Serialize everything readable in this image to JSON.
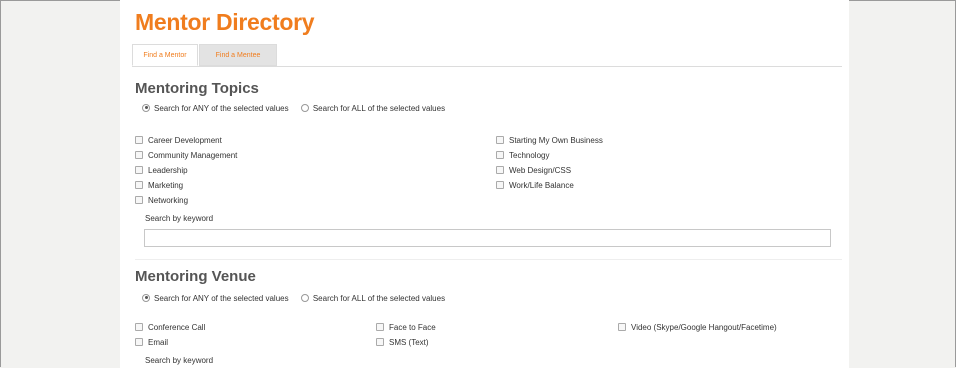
{
  "page_title": "Mentor Directory",
  "tabs": [
    {
      "label": "Find a Mentor",
      "active": true
    },
    {
      "label": "Find a Mentee",
      "active": false
    }
  ],
  "topics": {
    "title": "Mentoring Topics",
    "radio_any": "Search for ANY of the selected values",
    "radio_all": "Search for ALL of the selected values",
    "options_col1": [
      "Career Development",
      "Community Management",
      "Leadership",
      "Marketing",
      "Networking"
    ],
    "options_col2": [
      "Starting My Own Business",
      "Technology",
      "Web Design/CSS",
      "Work/Life Balance"
    ],
    "keyword_label": "Search by keyword",
    "keyword_value": ""
  },
  "venue": {
    "title": "Mentoring Venue",
    "radio_any": "Search for ANY of the selected values",
    "radio_all": "Search for ALL of the selected values",
    "options_col1": [
      "Conference Call",
      "Email"
    ],
    "options_col2": [
      "Face to Face",
      "SMS (Text)"
    ],
    "options_col3": [
      "Video (Skype/Google Hangout/Facetime)"
    ],
    "keyword_label": "Search by keyword"
  },
  "colors": {
    "accent": "#f07d1e",
    "background": "#f2f2f0"
  }
}
